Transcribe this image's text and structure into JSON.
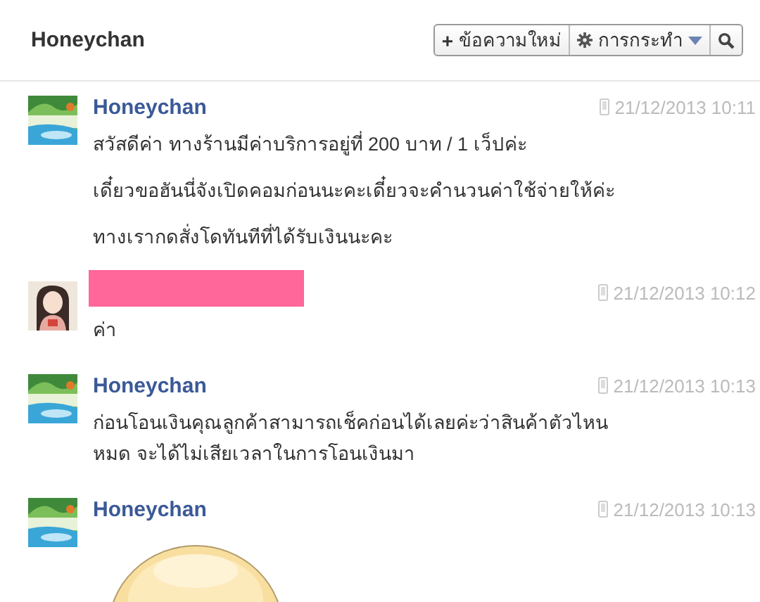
{
  "header": {
    "title": "Honeychan",
    "buttons": [
      {
        "kind": "new",
        "icon": "+",
        "label": "ข้อความใหม่"
      },
      {
        "kind": "actions",
        "label": "การกระทำ"
      },
      {
        "kind": "search"
      }
    ]
  },
  "messages": [
    {
      "sender": "Honeychan",
      "redacted": false,
      "avatar": {
        "kind": "picture"
      },
      "time": "21/12/2013 10:11",
      "paragraphs": [
        [
          "สวัสดีค่า ทางร้านมีค่าบริการอยู่ที่ 200 บาท / 1 เว็ปค่ะ"
        ],
        [
          "เดี๋ยวขอฮันนี่จังเปิดคอมก่อนนะคะเดี๋ยวจะคำนวนค่าใช้จ่ายให้ค่ะ"
        ],
        [
          "ทางเรากดสั่งโดทันทีที่ได้รับเงินนะคะ"
        ]
      ]
    },
    {
      "redacted": true,
      "avatar": {
        "kind": "picture"
      },
      "time": "21/12/2013 10:12",
      "paragraphs": [
        [
          "ค่า"
        ]
      ]
    },
    {
      "sender": "Honeychan",
      "redacted": false,
      "avatar": {
        "kind": "picture"
      },
      "time": "21/12/2013 10:13",
      "paragraphs": [
        [
          "ก่อนโอนเงินคุณลูกค้าสามารถเช็คก่อนได้เลยค่ะว่าสินค้าตัวไหน",
          "หมด จะได้ไม่เสียเวลาในการโอนเงินมา"
        ]
      ]
    },
    {
      "sender": "Honeychan",
      "redacted": false,
      "avatar": {
        "kind": "picture"
      },
      "time": "21/12/2013 10:13",
      "sticker": {
        "kind": "picture"
      }
    }
  ]
}
